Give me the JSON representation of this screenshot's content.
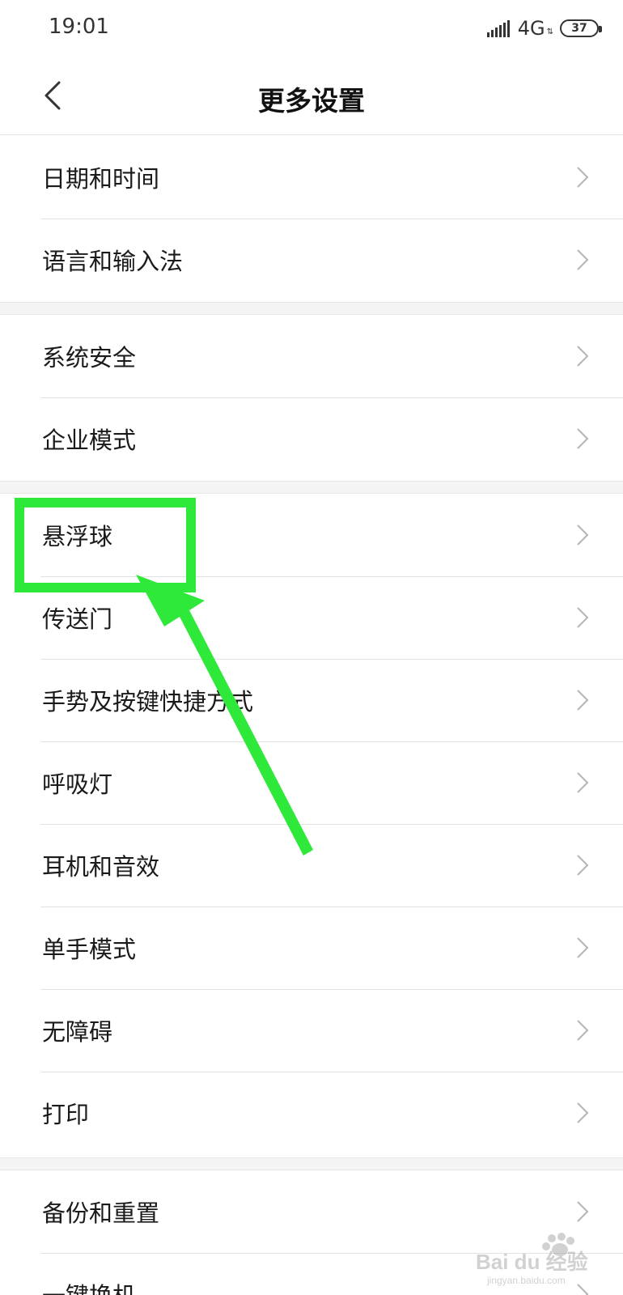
{
  "status_bar": {
    "time": "19:01",
    "network": "4G",
    "battery": "37"
  },
  "header": {
    "title": "更多设置"
  },
  "sections": [
    {
      "items": [
        {
          "label": "日期和时间"
        },
        {
          "label": "语言和输入法"
        }
      ]
    },
    {
      "items": [
        {
          "label": "系统安全"
        },
        {
          "label": "企业模式"
        }
      ]
    },
    {
      "items": [
        {
          "label": "悬浮球"
        },
        {
          "label": "传送门"
        },
        {
          "label": "手势及按键快捷方式"
        },
        {
          "label": "呼吸灯"
        },
        {
          "label": "耳机和音效"
        },
        {
          "label": "单手模式"
        },
        {
          "label": "无障碍"
        },
        {
          "label": "打印"
        }
      ]
    },
    {
      "items": [
        {
          "label": "备份和重置"
        },
        {
          "label": "一键换机"
        }
      ]
    }
  ],
  "annotation": {
    "highlight_color": "#2ee83a",
    "highlighted_item": "悬浮球"
  },
  "watermark": {
    "icon": "baidu-paw-icon",
    "text": "Bai du 经验",
    "url_text": "jingyan.baidu.com"
  },
  "colors": {
    "background": "#ffffff",
    "separator": "#e2e2e2",
    "section_gap": "#f4f4f4",
    "chevron": "#b5b5b5"
  }
}
